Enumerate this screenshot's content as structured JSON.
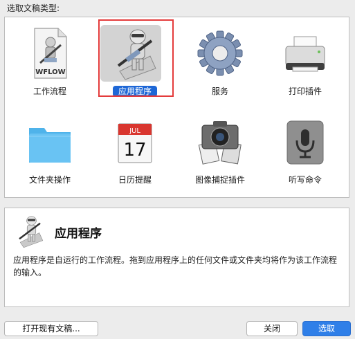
{
  "dialog": {
    "title": "选取文稿类型:"
  },
  "types": [
    {
      "label": "工作流程",
      "icon": "workflow-file-icon"
    },
    {
      "label": "应用程序",
      "icon": "automator-robot-icon",
      "selected": true
    },
    {
      "label": "服务",
      "icon": "gear-icon"
    },
    {
      "label": "打印插件",
      "icon": "printer-icon"
    },
    {
      "label": "文件夹操作",
      "icon": "folder-icon"
    },
    {
      "label": "日历提醒",
      "icon": "calendar-icon"
    },
    {
      "label": "图像捕捉插件",
      "icon": "image-capture-icon"
    },
    {
      "label": "听写命令",
      "icon": "microphone-icon"
    }
  ],
  "workflow_file_label": "WFLOW",
  "calendar": {
    "month": "JUL",
    "day": "17"
  },
  "description": {
    "title": "应用程序",
    "text": "应用程序是自运行的工作流程。拖到应用程序上的任何文件或文件夹均将作为该工作流程的输入。"
  },
  "buttons": {
    "open_existing": "打开现有文稿...",
    "close": "关闭",
    "choose": "选取"
  },
  "colors": {
    "selection_highlight": "#1e67d6",
    "selection_frame": "#e43b3b",
    "primary_button": "#2f7fe8"
  }
}
